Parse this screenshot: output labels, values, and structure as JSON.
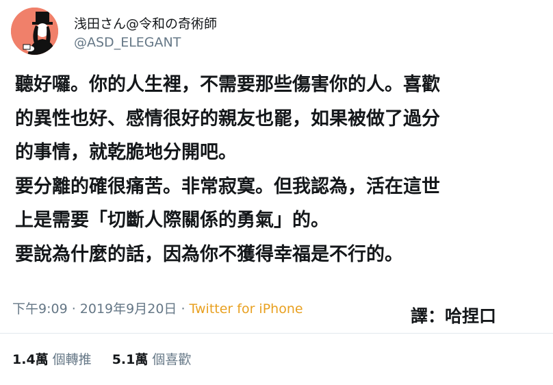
{
  "author": {
    "display_name": "浅田さん@令和の奇術師",
    "handle": "@ASD_ELEGANT"
  },
  "tweet": {
    "lines": [
      "聽好囉。你的人生裡，不需要那些傷害你的人。喜歡",
      "的異性也好、感情很好的親友也罷，如果被做了過分",
      "的事情，就乾脆地分開吧。",
      "要分離的確很痛苦。非常寂寞。但我認為，活在這世",
      "上是需要「切斷人際關係的勇氣」的。",
      "要說為什麼的話，因為你不獲得幸福是不行的。"
    ]
  },
  "meta": {
    "time": "下午9:09",
    "separator1": " · ",
    "date": "2019年9月20日",
    "separator2": " · ",
    "source": "Twitter for iPhone"
  },
  "translator": "譯：哈捏口",
  "stats": {
    "retweets_count": "1.4萬",
    "retweets_label": "個轉推",
    "likes_count": "5.1萬",
    "likes_label": "個喜歡"
  },
  "colors": {
    "avatar_bg": "#f0806a",
    "source_link": "#e8a020",
    "muted": "#657786"
  }
}
